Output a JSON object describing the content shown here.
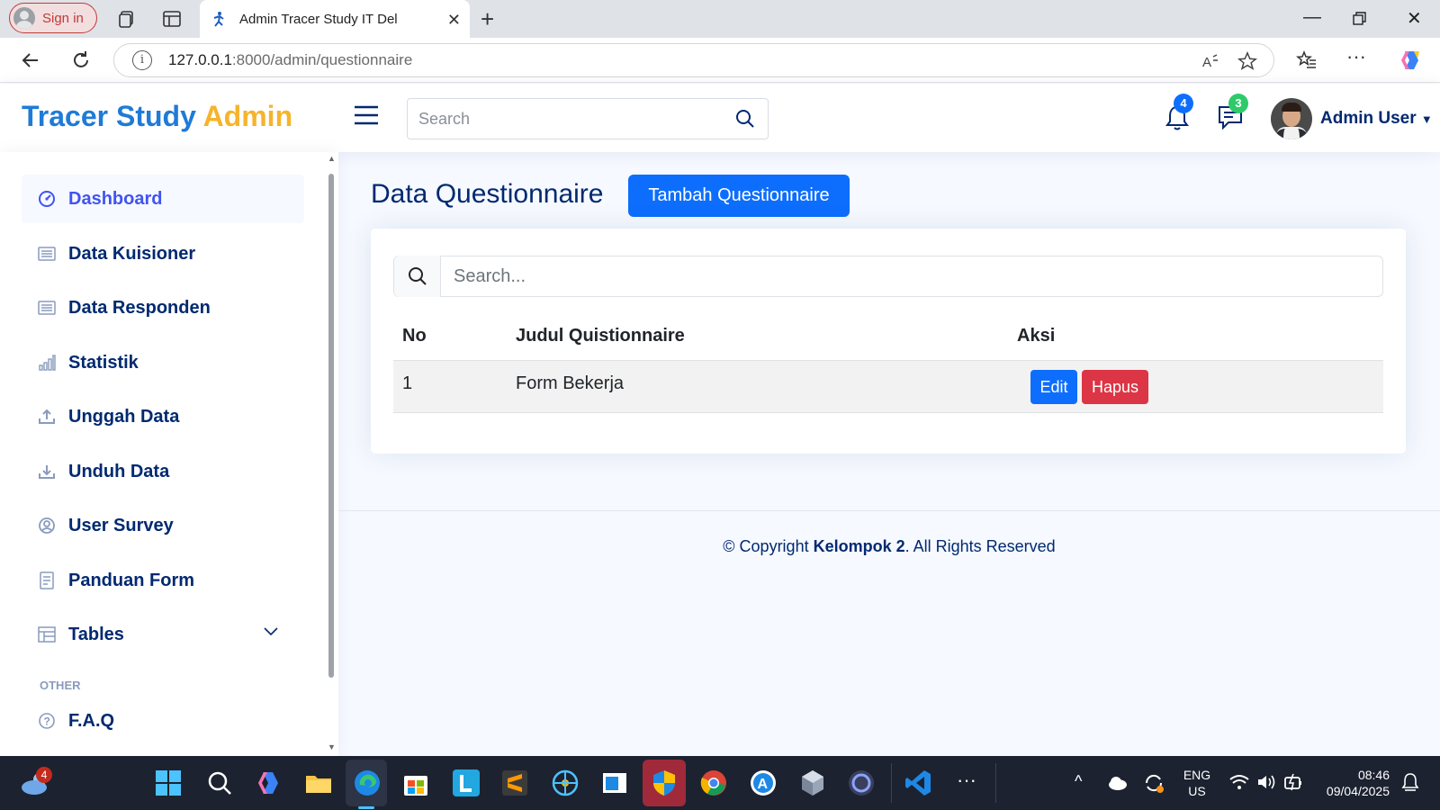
{
  "browser": {
    "signin_label": "Sign in",
    "tab_title": "Admin Tracer Study IT Del",
    "url_host": "127.0.0.1",
    "url_path": ":8000/admin/questionnaire"
  },
  "header": {
    "logo_part1": "Tracer Study",
    "logo_part2": "Admin",
    "search_placeholder": "Search",
    "notifications_count": "4",
    "messages_count": "3",
    "username": "Admin User"
  },
  "sidebar": {
    "items": [
      {
        "label": "Dashboard",
        "icon": "dashboard-icon"
      },
      {
        "label": "Data Kuisioner",
        "icon": "list-icon"
      },
      {
        "label": "Data Responden",
        "icon": "list-icon"
      },
      {
        "label": "Statistik",
        "icon": "bar-chart-icon"
      },
      {
        "label": "Unggah Data",
        "icon": "upload-icon"
      },
      {
        "label": "Unduh Data",
        "icon": "download-icon"
      },
      {
        "label": "User Survey",
        "icon": "user-circle-icon"
      },
      {
        "label": "Panduan Form",
        "icon": "document-icon"
      },
      {
        "label": "Tables",
        "icon": "table-icon"
      }
    ],
    "heading_other": "OTHER",
    "faq_label": "F.A.Q"
  },
  "main": {
    "page_title": "Data Questionnaire",
    "add_button": "Tambah Questionnaire",
    "search_placeholder": "Search...",
    "columns": [
      "No",
      "Judul Quistionnaire",
      "Aksi"
    ],
    "rows": [
      {
        "no": "1",
        "title": "Form Bekerja",
        "edit": "Edit",
        "delete": "Hapus"
      }
    ]
  },
  "footer": {
    "prefix": "© Copyright ",
    "brand": "Kelompok 2",
    "suffix": ". All Rights Reserved"
  },
  "taskbar": {
    "weather_badge": "4",
    "lang_top": "ENG",
    "lang_bottom": "US",
    "time": "08:46",
    "date": "09/04/2025"
  },
  "colors": {
    "primary": "#0d6efd",
    "danger": "#dc3545",
    "navy": "#012970",
    "logo_blue": "#1f7bd6",
    "logo_yellow": "#f6b42c"
  }
}
